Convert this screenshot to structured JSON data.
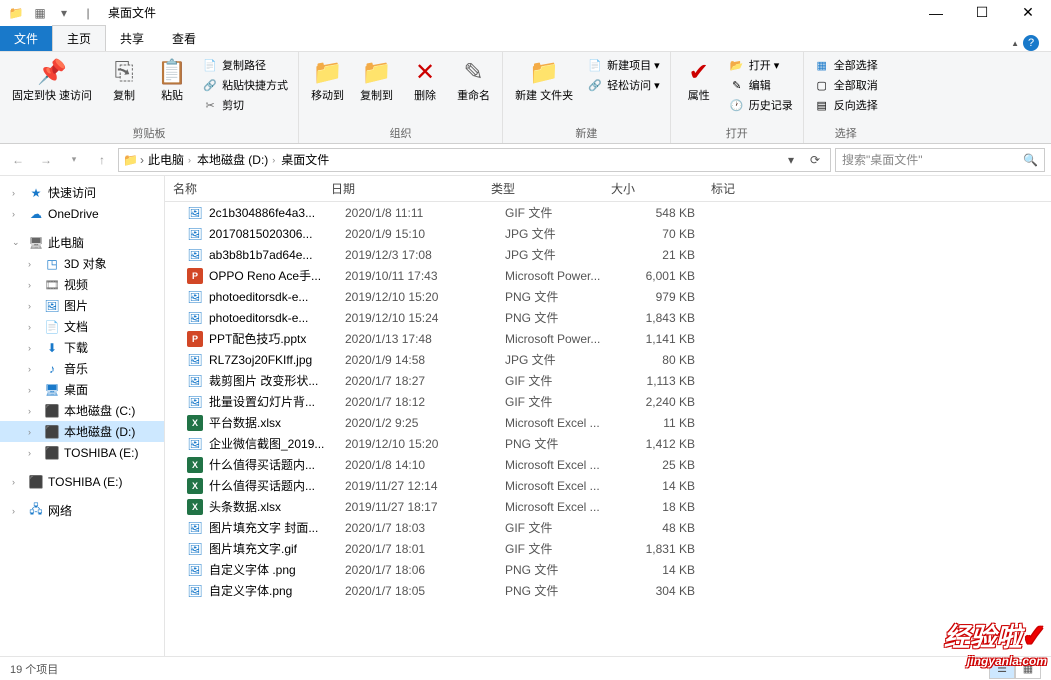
{
  "window": {
    "title": "桌面文件"
  },
  "tabs": {
    "file": "文件",
    "home": "主页",
    "share": "共享",
    "view": "查看"
  },
  "ribbon": {
    "clipboard": {
      "pin": "固定到快\n速访问",
      "copy": "复制",
      "paste": "粘贴",
      "copypath": "复制路径",
      "pasteshortcut": "粘贴快捷方式",
      "cut": "剪切",
      "label": "剪贴板"
    },
    "organize": {
      "moveto": "移动到",
      "copyto": "复制到",
      "delete": "删除",
      "rename": "重命名",
      "label": "组织"
    },
    "new": {
      "newfolder": "新建\n文件夹",
      "newitem": "新建项目 ▾",
      "easyaccess": "轻松访问 ▾",
      "label": "新建"
    },
    "open": {
      "properties": "属性",
      "open": "打开 ▾",
      "edit": "编辑",
      "history": "历史记录",
      "label": "打开"
    },
    "select": {
      "selectall": "全部选择",
      "selectnone": "全部取消",
      "invert": "反向选择",
      "label": "选择"
    }
  },
  "breadcrumbs": [
    "此电脑",
    "本地磁盘 (D:)",
    "桌面文件"
  ],
  "search": {
    "placeholder": "搜索\"桌面文件\""
  },
  "tree": [
    {
      "icon": "★",
      "label": "快速访问",
      "exp": ">",
      "color": "blue"
    },
    {
      "icon": "☁",
      "label": "OneDrive",
      "exp": ">",
      "color": "blue"
    },
    {
      "sep": true
    },
    {
      "icon": "🖥",
      "label": "此电脑",
      "exp": "v",
      "color": "gray"
    },
    {
      "icon": "◳",
      "label": "3D 对象",
      "exp": ">",
      "indent": 1,
      "color": "blue"
    },
    {
      "icon": "🎞",
      "label": "视频",
      "exp": ">",
      "indent": 1,
      "color": "gray"
    },
    {
      "icon": "🖼",
      "label": "图片",
      "exp": ">",
      "indent": 1,
      "color": "blue"
    },
    {
      "icon": "📄",
      "label": "文档",
      "exp": ">",
      "indent": 1,
      "color": "gray"
    },
    {
      "icon": "⬇",
      "label": "下载",
      "exp": ">",
      "indent": 1,
      "color": "blue"
    },
    {
      "icon": "♪",
      "label": "音乐",
      "exp": ">",
      "indent": 1,
      "color": "blue"
    },
    {
      "icon": "🖥",
      "label": "桌面",
      "exp": ">",
      "indent": 1,
      "color": "blue"
    },
    {
      "icon": "⬛",
      "label": "本地磁盘 (C:)",
      "exp": ">",
      "indent": 1,
      "color": "gray"
    },
    {
      "icon": "⬛",
      "label": "本地磁盘 (D:)",
      "exp": ">",
      "indent": 1,
      "color": "gray",
      "sel": true
    },
    {
      "icon": "⬛",
      "label": "TOSHIBA (E:)",
      "exp": ">",
      "indent": 1,
      "color": "gray"
    },
    {
      "sep": true
    },
    {
      "icon": "⬛",
      "label": "TOSHIBA (E:)",
      "exp": ">",
      "color": "gray"
    },
    {
      "sep": true
    },
    {
      "icon": "🖧",
      "label": "网络",
      "exp": ">",
      "color": "blue"
    }
  ],
  "columns": {
    "name": "名称",
    "date": "日期",
    "type": "类型",
    "size": "大小",
    "tags": "标记"
  },
  "files": [
    {
      "icon": "🖼",
      "name": "2c1b304886fe4a3...",
      "date": "2020/1/8 11:11",
      "type": "GIF 文件",
      "size": "548 KB"
    },
    {
      "icon": "🖼",
      "name": "20170815020306...",
      "date": "2020/1/9 15:10",
      "type": "JPG 文件",
      "size": "70 KB"
    },
    {
      "icon": "🖼",
      "name": "ab3b8b1b7ad64e...",
      "date": "2019/12/3 17:08",
      "type": "JPG 文件",
      "size": "21 KB"
    },
    {
      "icon": "P",
      "ic": "orange",
      "name": "OPPO Reno Ace手...",
      "date": "2019/10/11 17:43",
      "type": "Microsoft Power...",
      "size": "6,001 KB"
    },
    {
      "icon": "🖼",
      "name": "photoeditorsdk-e...",
      "date": "2019/12/10 15:20",
      "type": "PNG 文件",
      "size": "979 KB"
    },
    {
      "icon": "🖼",
      "name": "photoeditorsdk-e...",
      "date": "2019/12/10 15:24",
      "type": "PNG 文件",
      "size": "1,843 KB"
    },
    {
      "icon": "P",
      "ic": "orange",
      "name": "PPT配色技巧.pptx",
      "date": "2020/1/13 17:48",
      "type": "Microsoft Power...",
      "size": "1,141 KB"
    },
    {
      "icon": "🖼",
      "name": "RL7Z3oj20FKIff.jpg",
      "date": "2020/1/9 14:58",
      "type": "JPG 文件",
      "size": "80 KB"
    },
    {
      "icon": "🖼",
      "name": "裁剪图片 改变形状...",
      "date": "2020/1/7 18:27",
      "type": "GIF 文件",
      "size": "1,113 KB"
    },
    {
      "icon": "🖼",
      "name": "批量设置幻灯片背...",
      "date": "2020/1/7 18:12",
      "type": "GIF 文件",
      "size": "2,240 KB"
    },
    {
      "icon": "X",
      "ic": "green",
      "name": "平台数据.xlsx",
      "date": "2020/1/2 9:25",
      "type": "Microsoft Excel ...",
      "size": "11 KB"
    },
    {
      "icon": "🖼",
      "name": "企业微信截图_2019...",
      "date": "2019/12/10 15:20",
      "type": "PNG 文件",
      "size": "1,412 KB"
    },
    {
      "icon": "X",
      "ic": "green",
      "name": "什么值得买话题内...",
      "date": "2020/1/8 14:10",
      "type": "Microsoft Excel ...",
      "size": "25 KB"
    },
    {
      "icon": "X",
      "ic": "green",
      "name": "什么值得买话题内...",
      "date": "2019/11/27 12:14",
      "type": "Microsoft Excel ...",
      "size": "14 KB"
    },
    {
      "icon": "X",
      "ic": "green",
      "name": "头条数据.xlsx",
      "date": "2019/11/27 18:17",
      "type": "Microsoft Excel ...",
      "size": "18 KB"
    },
    {
      "icon": "🖼",
      "name": "图片填充文字 封面...",
      "date": "2020/1/7 18:03",
      "type": "GIF 文件",
      "size": "48 KB"
    },
    {
      "icon": "🖼",
      "name": "图片填充文字.gif",
      "date": "2020/1/7 18:01",
      "type": "GIF 文件",
      "size": "1,831 KB"
    },
    {
      "icon": "🖼",
      "name": "自定义字体 .png",
      "date": "2020/1/7 18:06",
      "type": "PNG 文件",
      "size": "14 KB"
    },
    {
      "icon": "🖼",
      "name": "自定义字体.png",
      "date": "2020/1/7 18:05",
      "type": "PNG 文件",
      "size": "304 KB"
    }
  ],
  "status": {
    "items": "19 个项目"
  },
  "watermark": {
    "big": "经验啦",
    "small": "jingyanla.com"
  }
}
